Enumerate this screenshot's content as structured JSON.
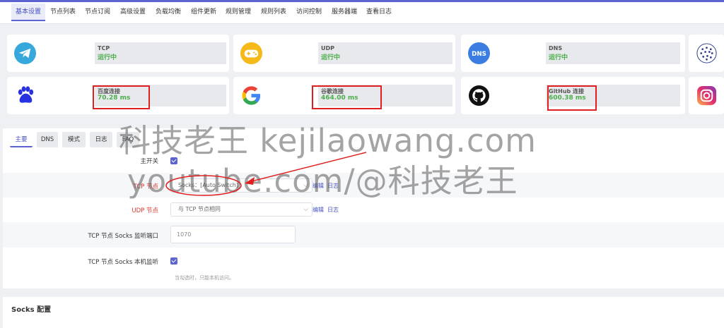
{
  "nav": {
    "tabs": [
      "基本设置",
      "节点列表",
      "节点订阅",
      "高级设置",
      "负载均衡",
      "组件更新",
      "规则管理",
      "规则列表",
      "访问控制",
      "服务器端",
      "查看日志"
    ]
  },
  "status": {
    "cards": [
      {
        "icon": "telegram-icon",
        "name": "TCP",
        "value": "运行中"
      },
      {
        "icon": "gamepad-icon",
        "name": "UDP",
        "value": "运行中"
      },
      {
        "icon": "dns-icon",
        "name": "DNS",
        "value": "运行中"
      },
      {
        "icon": "baidu-paw-icon",
        "name": "百度连接",
        "value": "70.28 ms"
      },
      {
        "icon": "google-icon",
        "name": "谷歌连接",
        "value": "464.00 ms"
      },
      {
        "icon": "github-icon",
        "name": "GitHub 连接",
        "value": "600.38 ms"
      }
    ],
    "dns_icon_text": "DNS"
  },
  "main": {
    "subtabs": [
      "主要",
      "DNS",
      "模式",
      "日志",
      "FAQ"
    ],
    "fields": {
      "master_switch": {
        "label": "主开关",
        "checked": true
      },
      "tcp_node": {
        "label": "TCP 节点",
        "value": "Socks：[Auto Switch]",
        "edit": "编辑",
        "log": "日志"
      },
      "udp_node": {
        "label": "UDP 节点",
        "value": "与 TCP 节点相同",
        "edit": "编辑",
        "log": "日志"
      },
      "socks_port": {
        "label": "TCP 节点 Socks 监听端口",
        "placeholder": "1070"
      },
      "socks_local": {
        "label": "TCP 节点 Socks 本机监听",
        "checked": true,
        "hint": "当勾选时，只能本机访问。"
      }
    }
  },
  "socks": {
    "title": "Socks 配置"
  },
  "watermark": {
    "line1": "科技老王 kejilaowang.com",
    "line2": "youtube.com/@科技老王"
  },
  "colors": {
    "accent": "#5b64d1",
    "running": "#4cae4c",
    "annotation": "#e02020",
    "required": "#e0332e"
  }
}
